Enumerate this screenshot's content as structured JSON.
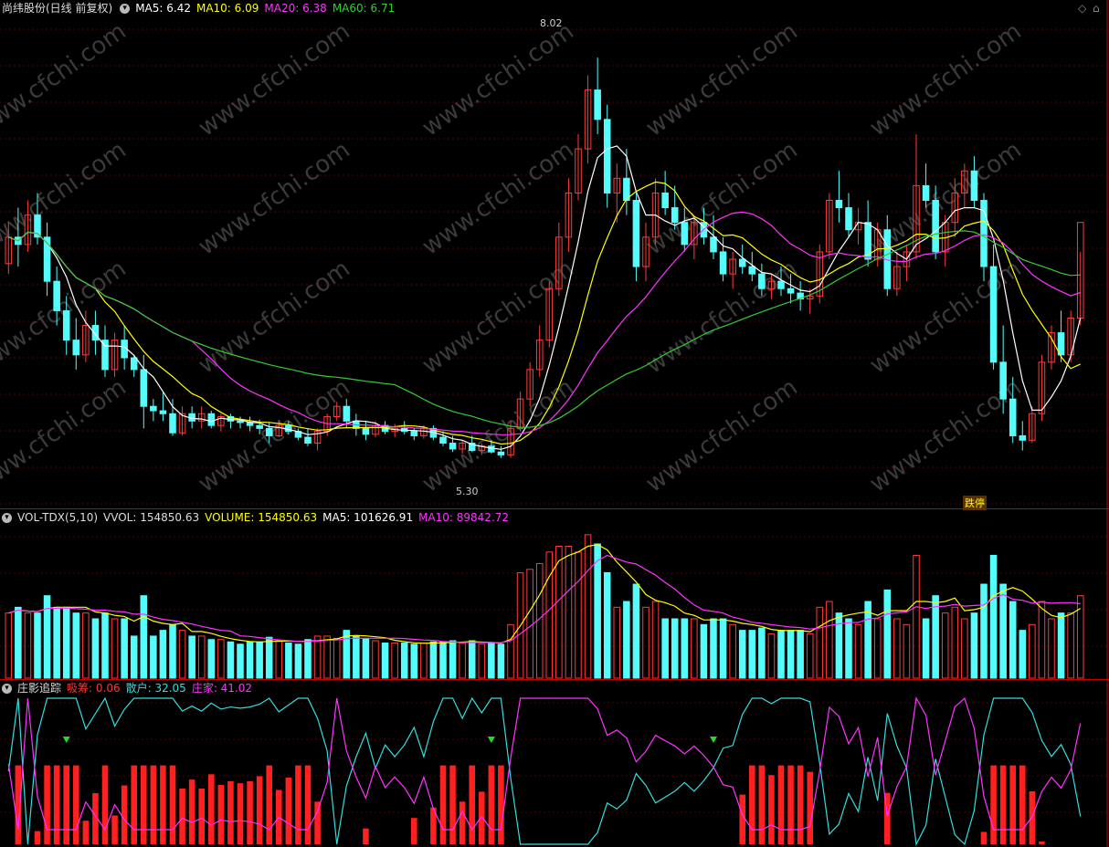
{
  "main": {
    "title": "尚纬股份(日线 前复权)",
    "indicators": [
      {
        "label": "MA5: 6.42",
        "color": "#ffffff"
      },
      {
        "label": "MA10: 6.09",
        "color": "#ffff00"
      },
      {
        "label": "MA20: 6.38",
        "color": "#ff33ff"
      },
      {
        "label": "MA60: 6.71",
        "color": "#33cc33"
      }
    ],
    "high_label": "8.02",
    "low_label": "5.30",
    "signal_label": "跌停"
  },
  "volume": {
    "title": "VOL-TDX(5,10)",
    "indicators": [
      {
        "label": "VVOL: 154850.63",
        "color": "#dddddd"
      },
      {
        "label": "VOLUME: 154850.63",
        "color": "#ffff00"
      },
      {
        "label": "MA5: 101626.91",
        "color": "#ffffff"
      },
      {
        "label": "MA10: 89842.72",
        "color": "#ff33ff"
      }
    ]
  },
  "zy": {
    "title": "庄影追踪",
    "indicators": [
      {
        "label": "吸筹: 0.06",
        "color": "#ff3333"
      },
      {
        "label": "散户: 32.05",
        "color": "#33dddd"
      },
      {
        "label": "庄家: 41.02",
        "color": "#ff33ff"
      }
    ]
  },
  "watermark": "www.cfchi.com",
  "colors": {
    "up": "#ff3b3b",
    "down": "#54fcfc",
    "grid": "#8b0000",
    "border": "#c80000"
  },
  "chart_data": {
    "type": "candlestick",
    "price_range": [
      5.0,
      8.3
    ],
    "ohlc": [
      [
        6.62,
        6.9,
        6.55,
        6.8
      ],
      [
        6.8,
        7.0,
        6.6,
        6.75
      ],
      [
        6.75,
        7.05,
        6.7,
        6.95
      ],
      [
        6.95,
        7.1,
        6.75,
        6.8
      ],
      [
        6.8,
        6.9,
        6.4,
        6.5
      ],
      [
        6.5,
        6.6,
        6.2,
        6.3
      ],
      [
        6.3,
        6.4,
        6.0,
        6.1
      ],
      [
        6.1,
        6.25,
        5.9,
        6.0
      ],
      [
        6.0,
        6.3,
        5.95,
        6.2
      ],
      [
        6.2,
        6.3,
        6.0,
        6.1
      ],
      [
        6.1,
        6.2,
        5.85,
        5.9
      ],
      [
        5.9,
        6.15,
        5.85,
        6.1
      ],
      [
        6.1,
        6.2,
        5.9,
        5.98
      ],
      [
        5.98,
        6.0,
        5.85,
        5.9
      ],
      [
        5.9,
        6.0,
        5.5,
        5.65
      ],
      [
        5.65,
        5.7,
        5.55,
        5.62
      ],
      [
        5.62,
        5.75,
        5.55,
        5.6
      ],
      [
        5.6,
        5.7,
        5.45,
        5.47
      ],
      [
        5.47,
        5.65,
        5.45,
        5.6
      ],
      [
        5.6,
        5.65,
        5.5,
        5.55
      ],
      [
        5.55,
        5.65,
        5.5,
        5.6
      ],
      [
        5.6,
        5.62,
        5.5,
        5.52
      ],
      [
        5.52,
        5.6,
        5.48,
        5.58
      ],
      [
        5.58,
        5.6,
        5.5,
        5.55
      ],
      [
        5.55,
        5.58,
        5.5,
        5.54
      ],
      [
        5.54,
        5.58,
        5.48,
        5.52
      ],
      [
        5.52,
        5.56,
        5.46,
        5.5
      ],
      [
        5.5,
        5.54,
        5.4,
        5.45
      ],
      [
        5.45,
        5.55,
        5.44,
        5.52
      ],
      [
        5.52,
        5.55,
        5.46,
        5.48
      ],
      [
        5.48,
        5.5,
        5.42,
        5.44
      ],
      [
        5.44,
        5.5,
        5.38,
        5.4
      ],
      [
        5.4,
        5.5,
        5.35,
        5.48
      ],
      [
        5.48,
        5.6,
        5.45,
        5.58
      ],
      [
        5.58,
        5.68,
        5.55,
        5.65
      ],
      [
        5.65,
        5.7,
        5.5,
        5.55
      ],
      [
        5.55,
        5.6,
        5.45,
        5.5
      ],
      [
        5.5,
        5.55,
        5.42,
        5.46
      ],
      [
        5.46,
        5.55,
        5.44,
        5.52
      ],
      [
        5.52,
        5.55,
        5.46,
        5.48
      ],
      [
        5.48,
        5.53,
        5.44,
        5.5
      ],
      [
        5.5,
        5.55,
        5.46,
        5.48
      ],
      [
        5.48,
        5.5,
        5.42,
        5.45
      ],
      [
        5.45,
        5.52,
        5.43,
        5.5
      ],
      [
        5.5,
        5.52,
        5.42,
        5.44
      ],
      [
        5.44,
        5.48,
        5.38,
        5.4
      ],
      [
        5.4,
        5.45,
        5.34,
        5.36
      ],
      [
        5.36,
        5.42,
        5.33,
        5.4
      ],
      [
        5.4,
        5.45,
        5.34,
        5.35
      ],
      [
        5.35,
        5.4,
        5.32,
        5.38
      ],
      [
        5.38,
        5.42,
        5.33,
        5.34
      ],
      [
        5.34,
        5.38,
        5.3,
        5.32
      ],
      [
        5.32,
        5.55,
        5.3,
        5.5
      ],
      [
        5.5,
        5.75,
        5.48,
        5.7
      ],
      [
        5.7,
        5.95,
        5.65,
        5.9
      ],
      [
        5.9,
        6.2,
        5.85,
        6.1
      ],
      [
        6.1,
        6.5,
        6.05,
        6.45
      ],
      [
        6.45,
        6.9,
        6.4,
        6.8
      ],
      [
        6.8,
        7.2,
        6.7,
        7.1
      ],
      [
        7.1,
        7.5,
        7.05,
        7.4
      ],
      [
        7.4,
        7.9,
        7.3,
        7.8
      ],
      [
        7.8,
        8.02,
        7.5,
        7.6
      ],
      [
        7.6,
        7.7,
        7.0,
        7.1
      ],
      [
        7.1,
        7.3,
        6.9,
        7.2
      ],
      [
        7.2,
        7.4,
        6.95,
        7.05
      ],
      [
        7.05,
        7.1,
        6.5,
        6.6
      ],
      [
        6.6,
        6.9,
        6.5,
        6.8
      ],
      [
        6.8,
        7.2,
        6.75,
        7.1
      ],
      [
        7.1,
        7.25,
        6.95,
        7.0
      ],
      [
        7.0,
        7.15,
        6.85,
        6.9
      ],
      [
        6.9,
        7.0,
        6.7,
        6.75
      ],
      [
        6.75,
        6.95,
        6.65,
        6.9
      ],
      [
        6.9,
        7.0,
        6.75,
        6.8
      ],
      [
        6.8,
        6.95,
        6.65,
        6.7
      ],
      [
        6.7,
        6.8,
        6.5,
        6.55
      ],
      [
        6.55,
        6.7,
        6.45,
        6.65
      ],
      [
        6.65,
        6.75,
        6.55,
        6.6
      ],
      [
        6.6,
        6.7,
        6.5,
        6.55
      ],
      [
        6.55,
        6.62,
        6.4,
        6.45
      ],
      [
        6.45,
        6.55,
        6.38,
        6.5
      ],
      [
        6.5,
        6.6,
        6.4,
        6.45
      ],
      [
        6.45,
        6.55,
        6.35,
        6.42
      ],
      [
        6.42,
        6.5,
        6.3,
        6.38
      ],
      [
        6.38,
        6.45,
        6.28,
        6.4
      ],
      [
        6.4,
        6.75,
        6.35,
        6.7
      ],
      [
        6.7,
        7.1,
        6.65,
        7.05
      ],
      [
        7.05,
        7.25,
        6.9,
        7.0
      ],
      [
        7.0,
        7.1,
        6.8,
        6.85
      ],
      [
        6.85,
        7.0,
        6.75,
        6.9
      ],
      [
        6.9,
        7.05,
        6.6,
        6.65
      ],
      [
        6.65,
        6.9,
        6.6,
        6.85
      ],
      [
        6.85,
        6.95,
        6.4,
        6.45
      ],
      [
        6.45,
        6.7,
        6.4,
        6.6
      ],
      [
        6.6,
        6.75,
        6.5,
        6.7
      ],
      [
        6.7,
        7.5,
        6.65,
        7.15
      ],
      [
        7.15,
        7.3,
        7.0,
        7.05
      ],
      [
        7.05,
        7.15,
        6.65,
        6.7
      ],
      [
        6.7,
        6.95,
        6.6,
        6.9
      ],
      [
        6.9,
        7.2,
        6.8,
        7.1
      ],
      [
        7.1,
        7.3,
        7.0,
        7.25
      ],
      [
        7.25,
        7.35,
        7.0,
        7.05
      ],
      [
        7.05,
        7.1,
        6.5,
        6.6
      ],
      [
        6.6,
        6.75,
        5.9,
        5.95
      ],
      [
        5.95,
        6.2,
        5.6,
        5.7
      ],
      [
        5.7,
        5.85,
        5.4,
        5.45
      ],
      [
        5.45,
        5.55,
        5.35,
        5.42
      ],
      [
        5.42,
        5.65,
        5.4,
        5.6
      ],
      [
        5.6,
        6.0,
        5.55,
        5.95
      ],
      [
        5.95,
        6.2,
        5.9,
        6.15
      ],
      [
        6.15,
        6.3,
        5.95,
        6.0
      ],
      [
        6.0,
        6.3,
        5.95,
        6.25
      ],
      [
        6.25,
        6.7,
        6.2,
        6.9
      ]
    ]
  }
}
